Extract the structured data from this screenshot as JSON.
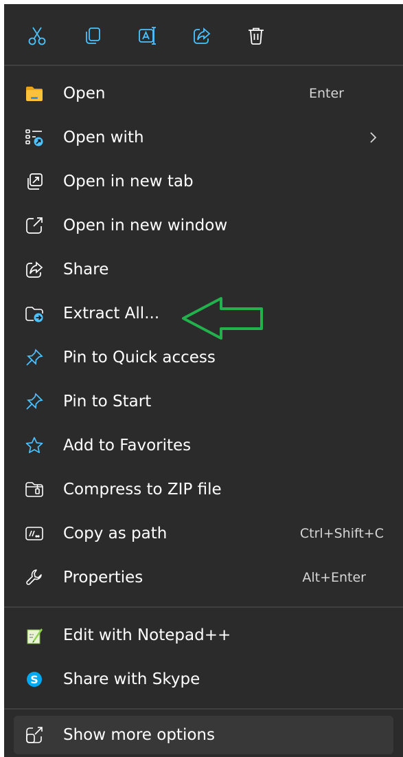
{
  "toolbar": {
    "buttons": [
      {
        "name": "cut",
        "icon": "scissors-icon"
      },
      {
        "name": "copy",
        "icon": "copy-icon"
      },
      {
        "name": "rename",
        "icon": "rename-icon"
      },
      {
        "name": "share",
        "icon": "share-icon"
      },
      {
        "name": "delete",
        "icon": "trash-icon"
      }
    ]
  },
  "menu": {
    "items": [
      {
        "label": "Open",
        "shortcut": "Enter",
        "icon": "folder-icon"
      },
      {
        "label": "Open with",
        "shortcut": "",
        "icon": "open-with-icon",
        "submenu": true
      },
      {
        "label": "Open in new tab",
        "shortcut": "",
        "icon": "new-tab-icon"
      },
      {
        "label": "Open in new window",
        "shortcut": "",
        "icon": "new-window-icon"
      },
      {
        "label": "Share",
        "shortcut": "",
        "icon": "share-icon"
      },
      {
        "label": "Extract All...",
        "shortcut": "",
        "icon": "extract-folder-icon"
      },
      {
        "label": "Pin to Quick access",
        "shortcut": "",
        "icon": "pin-icon"
      },
      {
        "label": "Pin to Start",
        "shortcut": "",
        "icon": "pin-icon"
      },
      {
        "label": "Add to Favorites",
        "shortcut": "",
        "icon": "star-icon"
      },
      {
        "label": "Compress to ZIP file",
        "shortcut": "",
        "icon": "zip-folder-icon"
      },
      {
        "label": "Copy as path",
        "shortcut": "Ctrl+Shift+C",
        "icon": "copy-path-icon"
      },
      {
        "label": "Properties",
        "shortcut": "Alt+Enter",
        "icon": "wrench-icon"
      }
    ],
    "extra_items": [
      {
        "label": "Edit with Notepad++",
        "icon": "notepad-plus-plus-icon"
      },
      {
        "label": "Share with Skype",
        "icon": "skype-icon"
      }
    ],
    "more_options": {
      "label": "Show more options",
      "icon": "show-more-icon"
    }
  },
  "colors": {
    "menu_background": "#2b2b2b",
    "accent_blue": "#4cc2ff",
    "folder_yellow": "#f8c23a",
    "annotation_green": "#22b14c"
  }
}
